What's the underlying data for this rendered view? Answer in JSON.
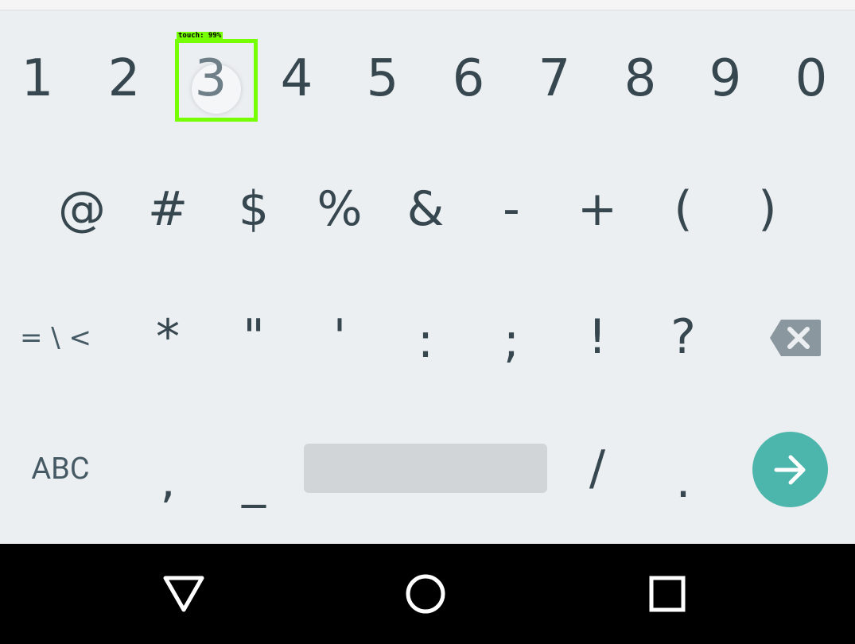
{
  "keyboard": {
    "digits": [
      "1",
      "2",
      "3",
      "4",
      "5",
      "6",
      "7",
      "8",
      "9",
      "0"
    ],
    "symbols_row": [
      "@",
      "#",
      "$",
      "%",
      "&",
      "-",
      "+",
      "(",
      ")"
    ],
    "third_row": {
      "toggle_label": "= \\ <",
      "keys": [
        "*",
        "\"",
        "'",
        ":",
        ";",
        "!",
        "?"
      ]
    },
    "bottom_row": {
      "abc_label": "ABC",
      "comma": ",",
      "underscore": "_",
      "slash": "/",
      "period": "."
    },
    "enter_icon": "arrow-right-icon",
    "backspace_icon": "backspace-icon",
    "accent_color": "#4db6ac",
    "key_text_color": "#37474f"
  },
  "touch_overlay": {
    "label": "touch: 99%",
    "color": "#76ff03"
  },
  "navbar": {
    "back_icon": "back-triangle-icon",
    "home_icon": "home-circle-icon",
    "recents_icon": "recents-square-icon"
  }
}
